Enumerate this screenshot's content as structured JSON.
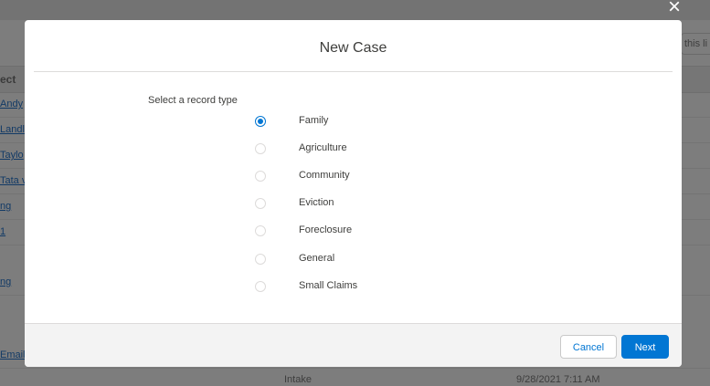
{
  "background": {
    "header_text": "ect",
    "search_placeholder": "this li",
    "row_links": [
      "Andy",
      "Landl",
      "Taylo",
      "Tata v",
      "ng",
      "1",
      "ng",
      "Email"
    ],
    "bottom_row": {
      "status": "Intake",
      "date": "9/28/2021 7:11 AM"
    }
  },
  "close_icon": "×",
  "modal": {
    "title": "New Case",
    "record_type_label": "Select a record type",
    "options": [
      {
        "label": "Family",
        "checked": true
      },
      {
        "label": "Agriculture",
        "checked": false
      },
      {
        "label": "Community",
        "checked": false
      },
      {
        "label": "Eviction",
        "checked": false
      },
      {
        "label": "Foreclosure",
        "checked": false
      },
      {
        "label": "General",
        "checked": false
      },
      {
        "label": "Small Claims",
        "checked": false
      }
    ],
    "cancel_label": "Cancel",
    "next_label": "Next"
  },
  "colors": {
    "brand": "#0176d3",
    "overlay": "#7d7d7d"
  }
}
